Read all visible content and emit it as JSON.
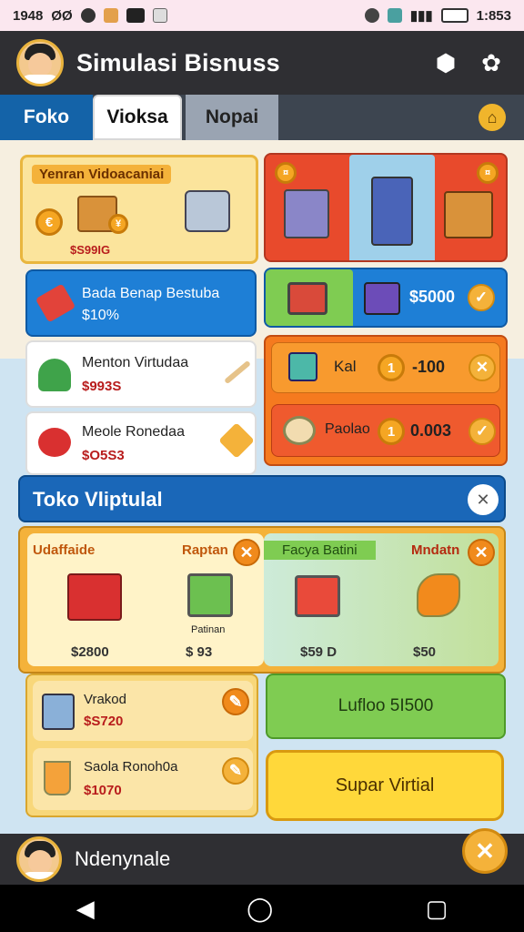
{
  "status": {
    "time": "1948",
    "left_text": "ØØ",
    "right_text": "1:853"
  },
  "header": {
    "title": "Simulasi Bisnuss"
  },
  "tabs": [
    {
      "label": "Foko"
    },
    {
      "label": "Vioksa"
    },
    {
      "label": "Nopai"
    }
  ],
  "top_left": {
    "banner": {
      "title": "Yenran Vidoacaniai",
      "price": "$S99IG"
    },
    "blue_card": {
      "line1": "Bada Benap Bestuba",
      "line2": "$10%"
    },
    "item1": {
      "name": "Menton Virtudaa",
      "price": "$993S"
    },
    "item2": {
      "name": "Meole Ronedaa",
      "price": "$O5S3"
    }
  },
  "top_right": {
    "cart_row": {
      "value": "$5000"
    },
    "orange_row1": {
      "label": "Kal",
      "value": "-100"
    },
    "orange_row2": {
      "label": "Paolao",
      "value": "0.003"
    }
  },
  "section": {
    "title": "Toko Vliptulal"
  },
  "shop": {
    "items": [
      {
        "label": "Udaffaide",
        "price": "$2800"
      },
      {
        "label": "Raptan",
        "sub": "Patinan",
        "price": "$ 93"
      },
      {
        "label": "Facya Batini",
        "price": "$59 D"
      },
      {
        "label": "Mndatn",
        "price": "$50"
      }
    ]
  },
  "bottom_left": {
    "row1": {
      "name": "Vrakod",
      "price": "$S720"
    },
    "row2": {
      "name": "Saola Ronoh0a",
      "price": "$1070"
    }
  },
  "green_button": {
    "label": "Lufloo 5I500"
  },
  "yellow_button": {
    "label": "Supar Virtial"
  },
  "footer": {
    "name": "Ndenynale"
  },
  "colors": {
    "accent": "#f4b23a",
    "header": "#2f2f33",
    "blue": "#1e7fd6",
    "red": "#e84a2c",
    "orange": "#f57a1f",
    "green": "#7fcc52"
  }
}
